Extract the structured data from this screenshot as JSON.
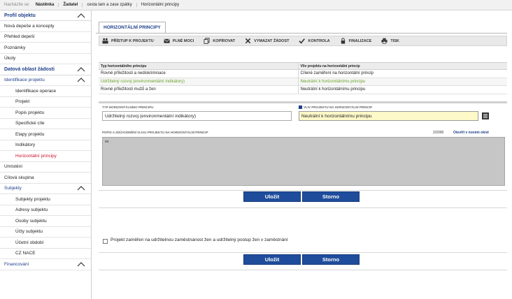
{
  "breadcrumb": {
    "label": "Nacházíte se:",
    "items": [
      "Nástěnka",
      "Žadatel",
      "cesta tam a zase zpátky",
      "Horizontální principy"
    ]
  },
  "sidebar": {
    "items": [
      {
        "label": "Profil objektu",
        "type": "header"
      },
      {
        "label": "Nová depeše a koncepty",
        "type": "item"
      },
      {
        "label": "Přehled depeší",
        "type": "item"
      },
      {
        "label": "Poznámky",
        "type": "item"
      },
      {
        "label": "Úkoly",
        "type": "item"
      },
      {
        "label": "Datová oblast žádosti",
        "type": "header"
      },
      {
        "label": "Identifikace projektu",
        "type": "group"
      },
      {
        "label": "Identifikace operace",
        "type": "sub"
      },
      {
        "label": "Projekt",
        "type": "sub"
      },
      {
        "label": "Popis projektu",
        "type": "sub"
      },
      {
        "label": "Specifické cíle",
        "type": "sub"
      },
      {
        "label": "Etapy projektu",
        "type": "sub"
      },
      {
        "label": "Indikátory",
        "type": "sub"
      },
      {
        "label": "Horizontální principy",
        "type": "sub-active"
      },
      {
        "label": "Umístění",
        "type": "item"
      },
      {
        "label": "Cílová skupina",
        "type": "item"
      },
      {
        "label": "Subjekty",
        "type": "group"
      },
      {
        "label": "Subjekty projektu",
        "type": "sub"
      },
      {
        "label": "Adresy subjektu",
        "type": "sub"
      },
      {
        "label": "Osoby subjektu",
        "type": "sub"
      },
      {
        "label": "Účty subjektu",
        "type": "sub"
      },
      {
        "label": "Účetní období",
        "type": "sub"
      },
      {
        "label": "CZ NACE",
        "type": "sub"
      },
      {
        "label": "Financování",
        "type": "group"
      }
    ]
  },
  "tab": {
    "label": "HORIZONTÁLNÍ PRINCIPY"
  },
  "toolbar": {
    "access": "PŘÍSTUP K PROJEKTU",
    "power": "PLNÉ MOCI",
    "copy": "KOPÍROVAT",
    "delete": "VYMAZAT ŽÁDOST",
    "check": "KONTROLA",
    "finalize": "FINALIZACE",
    "print": "TISK"
  },
  "table": {
    "headers": [
      "Typ horizontálního principu",
      "Vliv projektu na horizontální princip"
    ],
    "rows": [
      [
        "Rovné příležitosti a nediskriminace",
        "Cílené zaměření na horizontální princip"
      ],
      [
        "Udržitelný rozvoj (environmentální indikátory)",
        "Neutrální k horizontálnímu principu"
      ],
      [
        "Rovné příležitosti mužů a žen",
        "Neutrální k horizontálnímu principu"
      ]
    ]
  },
  "form": {
    "type_label": "TYP HORIZONTÁLNÍHO PRINCIPU",
    "type_value": "Udržitelný rozvoj (environmentální indikátory)",
    "impact_label": "VLIV PROJEKTU NA HORIZONTÁLNÍ PRINCIP",
    "impact_value": "Neutrální k horizontálnímu principu",
    "desc_label": "POPIS A ZDŮVODNĚNÍ VLIVU PROJEKTU NA HORIZONTÁLNÍ PRINCIP",
    "desc_counter": "2/2000",
    "desc_link": "Otevřít v novém okně",
    "desc_value": "xx",
    "save": "Uložit",
    "cancel": "Storno",
    "checkbox_label": "Projekt zaměřen na udržitelnou zaměstnanost žen a udržitelný postup žen v zaměstnání"
  },
  "colors": {
    "accent": "#1e3f8a",
    "button": "#1f4d9c",
    "active": "#c8102e",
    "selected_text": "#6aa32a",
    "highlight_field": "#fdf9c9"
  }
}
